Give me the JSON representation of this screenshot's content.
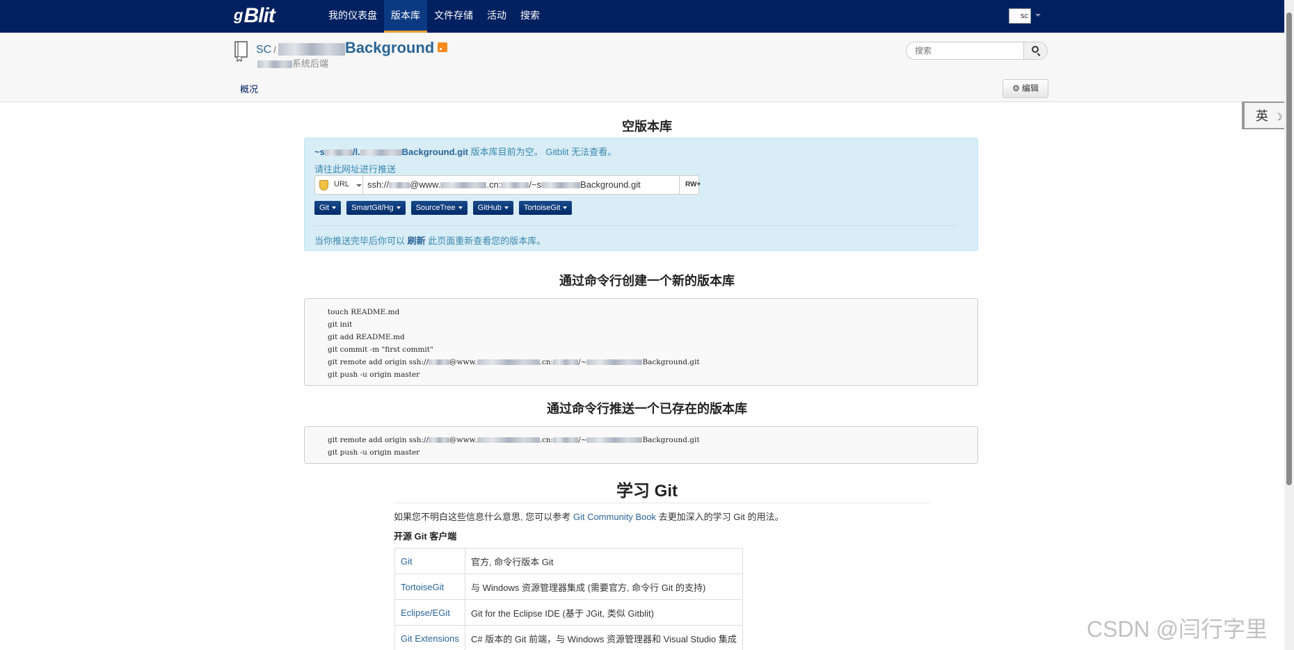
{
  "nav": {
    "brand": "Blit",
    "brand_prefix": "g",
    "items": [
      "我的仪表盘",
      "版本库",
      "文件存储",
      "活动",
      "搜索"
    ],
    "active_index": 1,
    "avatar_alt": "sc"
  },
  "repo": {
    "owner": "SC",
    "separator": "/",
    "name_suffix": "Background",
    "description_suffix": "系统后端",
    "overview_tab": "概况",
    "edit_label": "编辑"
  },
  "search": {
    "placeholder": "搜索"
  },
  "ime": {
    "label": "英",
    "moon": "☽"
  },
  "empty": {
    "title": "空版本库",
    "repo_prefix": "~s",
    "repo_suffix": "Background.git",
    "line1_rest": " 版本库目前为空。 Gitblit 无法查看。",
    "push_label": "请往此网址进行推送",
    "url_label": "URL",
    "url_prefix": "ssh://",
    "url_mid1": "@www.",
    "url_mid2": ".cn:",
    "url_mid3": "/~s",
    "url_suffix": "Background.git",
    "url_copy": "RW+",
    "client_buttons": [
      "Git",
      "SmartGit/Hg",
      "SourceTree",
      "GitHub",
      "TortoiseGit"
    ],
    "refresh_before": "当你推送完毕后你可以 ",
    "refresh_link": "刷新",
    "refresh_after": " 此页面重新查看您的版本库。"
  },
  "cli_new": {
    "title": "通过命令行创建一个新的版本库",
    "lines": [
      "touch README.md",
      "git init",
      "git add README.md",
      "git commit -m \"first commit\"",
      "git remote add origin ssh://",
      "git push -u origin master"
    ],
    "remote_suffix": "Background.git"
  },
  "cli_existing": {
    "title": "通过命令行推送一个已存在的版本库",
    "lines": [
      "git remote add origin ssh://",
      "git push -u origin master"
    ],
    "remote_suffix": "Background.git"
  },
  "learn": {
    "title": "学习 Git",
    "para_before": "如果您不明白这些信息什么意思, 您可以参考 ",
    "para_link": "Git Community Book",
    "para_after": " 去更加深入的学习 Git 的用法。",
    "subtitle": "开源 Git 客户端",
    "clients": [
      {
        "name": "Git",
        "desc": "官方, 命令行版本 Git"
      },
      {
        "name": "TortoiseGit",
        "desc": "与 Windows 资源管理器集成 (需要官方, 命令行 Git 的支持)"
      },
      {
        "name": "Eclipse/EGit",
        "desc": "Git for the Eclipse IDE (基于 JGit, 类似 Gitblit)"
      },
      {
        "name": "Git Extensions",
        "desc": "C# 版本的 Git 前端，与 Windows 资源管理器和 Visual Studio 集成"
      }
    ]
  },
  "watermark": "CSDN @闫行字里"
}
